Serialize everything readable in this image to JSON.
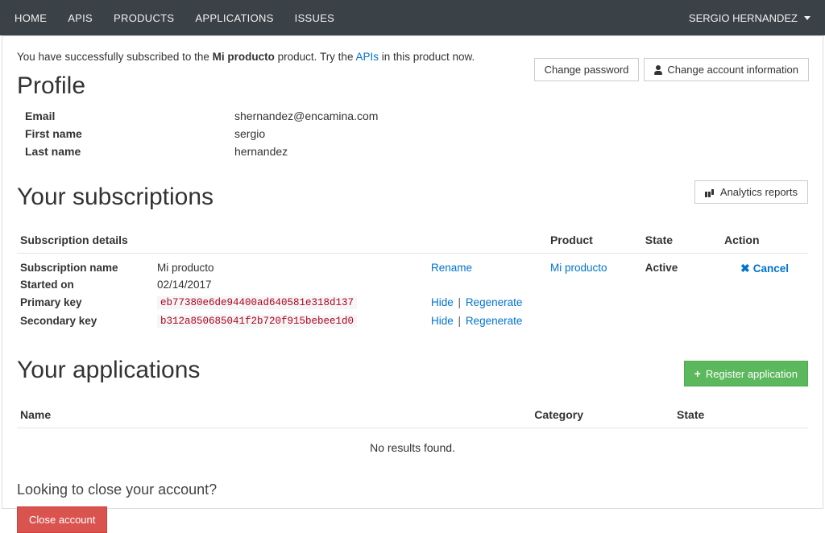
{
  "nav": {
    "items": [
      "HOME",
      "APIS",
      "PRODUCTS",
      "APPLICATIONS",
      "ISSUES"
    ],
    "user": "SERGIO HERNANDEZ"
  },
  "alert": {
    "pre": "You have successfully subscribed to the ",
    "product": "Mi producto",
    "mid": " product. Try the ",
    "link": "APIs",
    "post": " in this product now."
  },
  "actions": {
    "change_password": "Change password",
    "change_account": "Change account information"
  },
  "profile": {
    "title": "Profile",
    "rows": {
      "email_label": "Email",
      "email": "shernandez@encamina.com",
      "first_label": "First name",
      "first": "sergio",
      "last_label": "Last name",
      "last": "hernandez"
    }
  },
  "subs": {
    "title": "Your subscriptions",
    "analytics": "Analytics reports",
    "headers": {
      "details": "Subscription details",
      "product": "Product",
      "state": "State",
      "action": "Action"
    },
    "row": {
      "name_label": "Subscription name",
      "name": "Mi producto",
      "rename": "Rename",
      "started_label": "Started on",
      "started": "02/14/2017",
      "pkey_label": "Primary key",
      "pkey": "eb77380e6de94400ad640581e318d137",
      "skey_label": "Secondary key",
      "skey": "b312a850685041f2b720f915bebee1d0",
      "hide": "Hide",
      "regen": "Regenerate",
      "product_link": "Mi producto",
      "state": "Active",
      "cancel": "Cancel"
    }
  },
  "apps": {
    "title": "Your applications",
    "register": "Register application",
    "headers": {
      "name": "Name",
      "category": "Category",
      "state": "State"
    },
    "empty": "No results found."
  },
  "close": {
    "question": "Looking to close your account?",
    "button": "Close account"
  }
}
